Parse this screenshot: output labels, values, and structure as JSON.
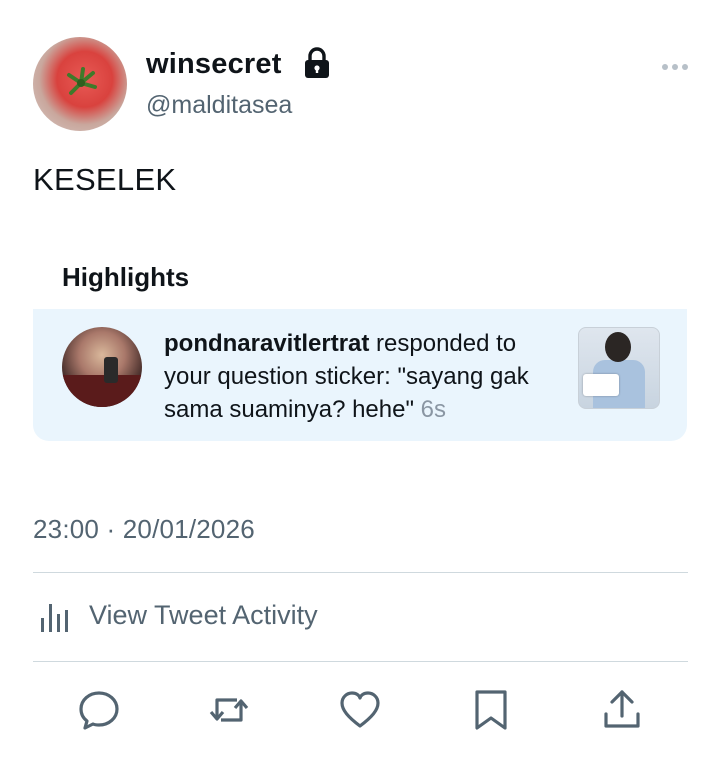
{
  "tweet": {
    "author": {
      "display_name": "winsecret",
      "handle": "@malditasea",
      "protected_icon": "lock-icon",
      "avatar": "tomato-avatar"
    },
    "menu_icon": "more-horizontal-icon",
    "text": "KESELEK",
    "timestamp": "23:00 · 20/01/2026"
  },
  "highlights": {
    "title": "Highlights",
    "item": {
      "username": "pondnaravitlertrat",
      "message": " responded to your question sticker: \"sayang gak sama suaminya? hehe\" ",
      "time": "6s"
    }
  },
  "activity": {
    "icon": "analytics-bars-icon",
    "label": "View Tweet Activity"
  },
  "actions": [
    {
      "name": "reply",
      "icon": "reply-bubble-icon"
    },
    {
      "name": "retweet",
      "icon": "retweet-icon"
    },
    {
      "name": "like",
      "icon": "heart-icon"
    },
    {
      "name": "bookmark",
      "icon": "bookmark-icon"
    },
    {
      "name": "share",
      "icon": "share-icon"
    }
  ],
  "colors": {
    "text_primary": "#0f1419",
    "text_secondary": "#536471",
    "highlight_bg": "#eaf5fd",
    "divider": "#cfd9de"
  }
}
